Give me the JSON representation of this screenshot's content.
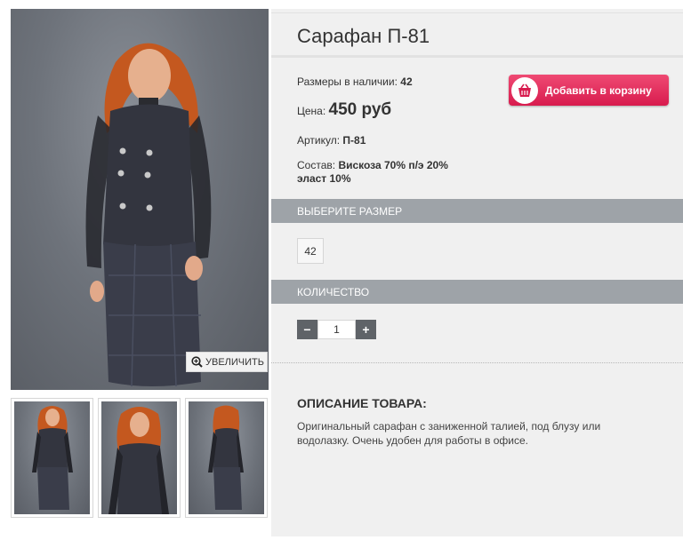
{
  "product": {
    "title": "Сарафан П-81",
    "sizes_label": "Размеры в наличии:",
    "sizes_value": "42",
    "price_label": "Цена:",
    "price_value": "450 руб",
    "article_label": "Артикул:",
    "article_value": "П-81",
    "composition_label": "Состав:",
    "composition_value_line1": "Вискоза 70% п/э 20%",
    "composition_value_line2": "эласт 10%"
  },
  "actions": {
    "add_to_cart_label": "Добавить в корзину",
    "zoom_label": "УВЕЛИЧИТЬ"
  },
  "size_section": {
    "header": "ВЫБЕРИТЕ РАЗМЕР",
    "options": [
      "42"
    ]
  },
  "quantity_section": {
    "header": "КОЛИЧЕСТВО",
    "minus": "−",
    "plus": "+",
    "value": "1"
  },
  "description": {
    "title": "ОПИСАНИЕ ТОВАРА:",
    "text": "Оригинальный сарафан с заниженной талией, под блузу или водолазку. Очень удобен для работы в офисе."
  },
  "colors": {
    "accent": "#d81b4e",
    "section_bar": "#9ea3a8",
    "panel_bg": "#f0f0f0"
  },
  "icons": {
    "zoom": "zoom-in-icon",
    "cart": "basket-icon"
  }
}
